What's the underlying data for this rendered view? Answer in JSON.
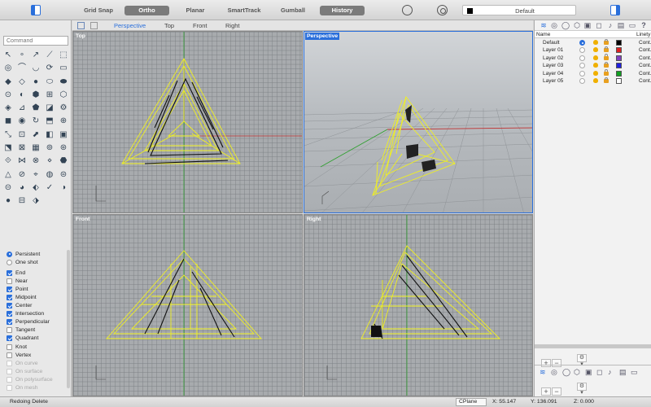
{
  "toolbar": {
    "modes": [
      {
        "label": "Grid Snap",
        "active": false
      },
      {
        "label": "Ortho",
        "active": true
      },
      {
        "label": "Planar",
        "active": false
      },
      {
        "label": "SmartTrack",
        "active": false
      },
      {
        "label": "Gumball",
        "active": false
      },
      {
        "label": "History",
        "active": true
      }
    ],
    "current_layer": "Default",
    "current_layer_color": "#000000"
  },
  "command": {
    "placeholder": "Command"
  },
  "tools": [
    "↖",
    "∘",
    "↗",
    "⟋",
    "⬚",
    "◎",
    "⌒",
    "◡",
    "⟳",
    "▭",
    "◆",
    "◇",
    "●",
    "⬭",
    "⬬",
    "⊙",
    "◐",
    "⬢",
    "⊞",
    "⬡",
    "◈",
    "⊿",
    "⬟",
    "◪",
    "⚙",
    "◼",
    "◉",
    "↻",
    "⬒",
    "⊕",
    "⤡",
    "⊡",
    "⬈",
    "◧",
    "▣",
    "⬔",
    "⊠",
    "▦",
    "⊚",
    "⊛",
    "⟐",
    "⋈",
    "⊗",
    "⋄",
    "⬣",
    "△",
    "⊘",
    "⌖",
    "◍",
    "⊜",
    "⊝",
    "◕",
    "⬖",
    "✓",
    "◑",
    "●",
    "⊟",
    "⬗"
  ],
  "osnaps": {
    "mode": [
      {
        "label": "Persistent",
        "selected": true
      },
      {
        "label": "One shot",
        "selected": false
      }
    ],
    "items": [
      {
        "label": "End",
        "checked": true,
        "dim": false
      },
      {
        "label": "Near",
        "checked": false,
        "dim": false
      },
      {
        "label": "Point",
        "checked": true,
        "dim": false
      },
      {
        "label": "Midpoint",
        "checked": true,
        "dim": false
      },
      {
        "label": "Center",
        "checked": true,
        "dim": false
      },
      {
        "label": "Intersection",
        "checked": true,
        "dim": false
      },
      {
        "label": "Perpendicular",
        "checked": true,
        "dim": false
      },
      {
        "label": "Tangent",
        "checked": false,
        "dim": false
      },
      {
        "label": "Quadrant",
        "checked": true,
        "dim": false
      },
      {
        "label": "Knot",
        "checked": false,
        "dim": false
      },
      {
        "label": "Vertex",
        "checked": false,
        "dim": false
      },
      {
        "label": "On curve",
        "checked": false,
        "dim": true
      },
      {
        "label": "On surface",
        "checked": false,
        "dim": true
      },
      {
        "label": "On polysurface",
        "checked": false,
        "dim": true
      },
      {
        "label": "On mesh",
        "checked": false,
        "dim": true
      }
    ]
  },
  "viewport_tabs": [
    {
      "label": "Perspective",
      "active": true
    },
    {
      "label": "Top",
      "active": false
    },
    {
      "label": "Front",
      "active": false
    },
    {
      "label": "Right",
      "active": false
    }
  ],
  "viewports": {
    "top": "Top",
    "perspective": "Perspective",
    "front": "Front",
    "right": "Right"
  },
  "layers": {
    "headers": {
      "name": "Name",
      "linetype": "Linety"
    },
    "rows": [
      {
        "name": "Default",
        "current": true,
        "color": "#000000",
        "linetype": "Cont."
      },
      {
        "name": "Layer 01",
        "current": false,
        "color": "#e02020",
        "linetype": "Cont."
      },
      {
        "name": "Layer 02",
        "current": false,
        "color": "#8040c0",
        "linetype": "Cont."
      },
      {
        "name": "Layer 03",
        "current": false,
        "color": "#2020e0",
        "linetype": "Cont."
      },
      {
        "name": "Layer 04",
        "current": false,
        "color": "#10a020",
        "linetype": "Cont."
      },
      {
        "name": "Layer 05",
        "current": false,
        "color": "#ffffff",
        "linetype": "Cont."
      }
    ]
  },
  "status": {
    "message": "Redoing Delete",
    "cplane": "CPlane",
    "x": "X: 55.147",
    "y": "Y: 136.091",
    "z": "Z: 0.000"
  },
  "colors": {
    "accent": "#2a6fdb",
    "wire": "#f0f020",
    "axis_x": "#c03030",
    "axis_y": "#30a030"
  }
}
